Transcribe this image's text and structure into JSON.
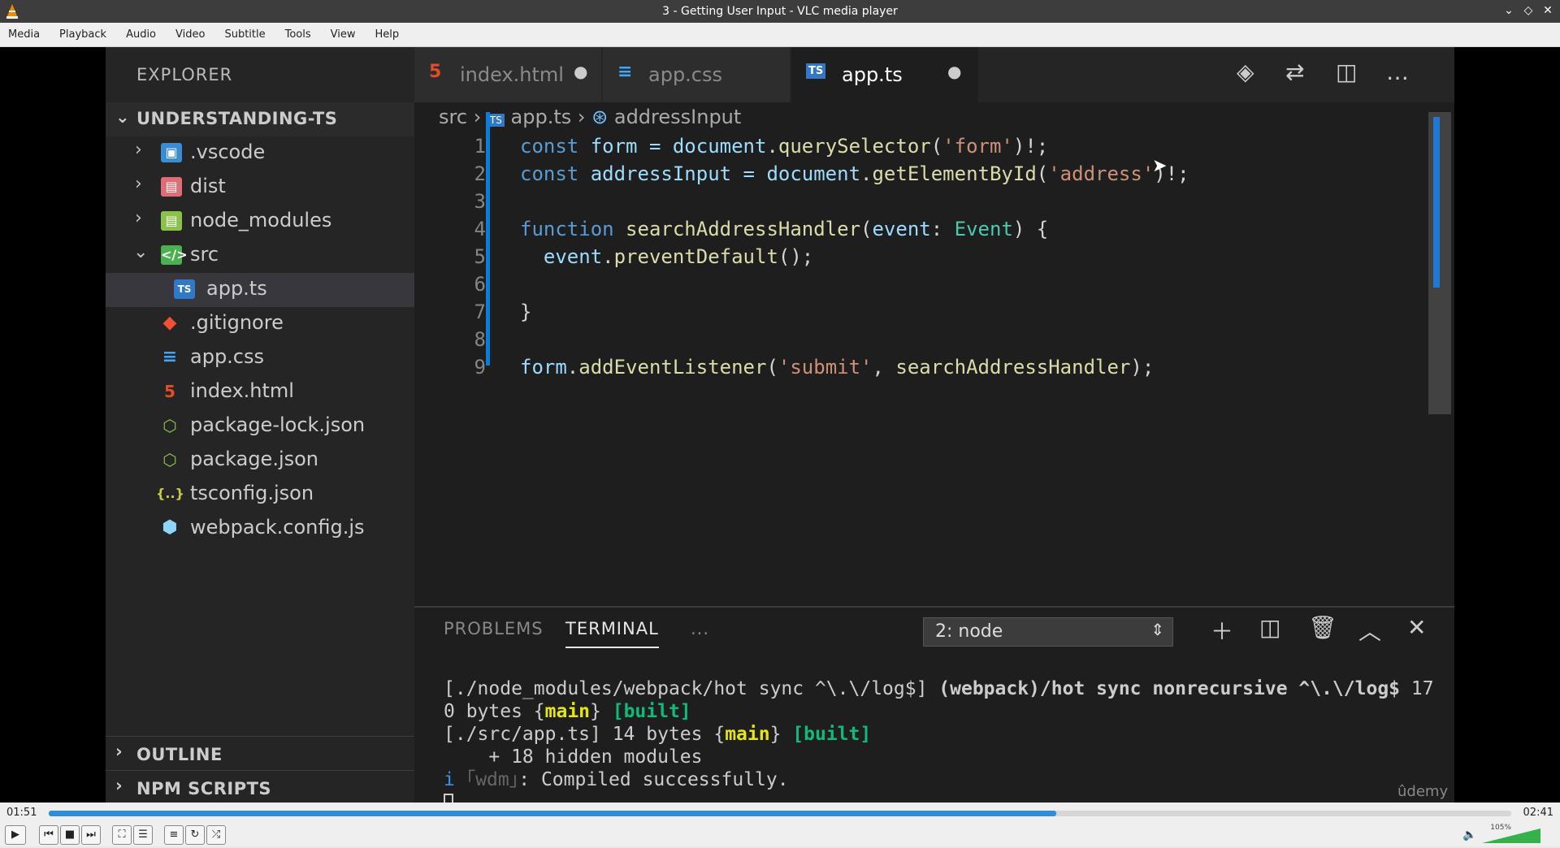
{
  "window": {
    "title": "3 - Getting User Input - VLC media player"
  },
  "menu": [
    "Media",
    "Playback",
    "Audio",
    "Video",
    "Subtitle",
    "Tools",
    "View",
    "Help"
  ],
  "explorer": {
    "title": "EXPLORER",
    "root": "UNDERSTANDING-TS",
    "items": [
      {
        "label": ".vscode",
        "icon": "folder-vscode-icon"
      },
      {
        "label": "dist",
        "icon": "folder-dist-icon"
      },
      {
        "label": "node_modules",
        "icon": "folder-node-icon"
      },
      {
        "label": "src",
        "icon": "folder-src-icon"
      },
      {
        "label": "app.ts",
        "icon": "ts-file-icon"
      },
      {
        "label": ".gitignore",
        "icon": "git-icon"
      },
      {
        "label": "app.css",
        "icon": "css-file-icon"
      },
      {
        "label": "index.html",
        "icon": "html-file-icon"
      },
      {
        "label": "package-lock.json",
        "icon": "node-file-icon"
      },
      {
        "label": "package.json",
        "icon": "node-file-icon"
      },
      {
        "label": "tsconfig.json",
        "icon": "json-file-icon"
      },
      {
        "label": "webpack.config.js",
        "icon": "webpack-icon"
      }
    ],
    "sections": [
      "OUTLINE",
      "NPM SCRIPTS"
    ]
  },
  "tabs": [
    {
      "label": "index.html",
      "icon": "html-file-icon"
    },
    {
      "label": "app.css",
      "icon": "css-file-icon"
    },
    {
      "label": "app.ts",
      "icon": "ts-file-icon"
    }
  ],
  "breadcrumb": {
    "folder": "src",
    "file": "app.ts",
    "symbol": "addressInput"
  },
  "code": {
    "line_numbers": [
      "1",
      "2",
      "3",
      "4",
      "5",
      "6",
      "7",
      "8",
      "9"
    ],
    "l1": {
      "a": "const",
      "b": " form = ",
      "c": "document",
      "d": ".",
      "e": "querySelector",
      "f": "(",
      "g": "'form'",
      "h": ")!;"
    },
    "l2": {
      "a": "const",
      "b": " addressInput = ",
      "c": "document",
      "d": ".",
      "e": "getElementById",
      "f": "(",
      "g": "'address'",
      "h": ")!;"
    },
    "l4": {
      "a": "function",
      "b": " ",
      "c": "searchAddressHandler",
      "d": "(",
      "e": "event",
      "f": ": ",
      "g": "Event",
      "h": ") {"
    },
    "l5": {
      "a": "  event",
      "b": ".",
      "c": "preventDefault",
      "d": "();"
    },
    "l7": {
      "a": "}"
    },
    "l9": {
      "a": "form",
      "b": ".",
      "c": "addEventListener",
      "d": "(",
      "e": "'submit'",
      "f": ", ",
      "g": "searchAddressHandler",
      "h": ");"
    }
  },
  "panel": {
    "tabs": [
      "PROBLEMS",
      "TERMINAL",
      "..."
    ],
    "select": "2: node",
    "terminal": {
      "l1a": "[./node_modules/webpack/hot sync ^\\.\\/log$] ",
      "l1b": "(webpack)/hot sync nonrecursive ^\\.\\/log$",
      "l1c": " 17",
      "l2a": "0 bytes {",
      "l2b": "main",
      "l2c": "} ",
      "l2d": "[built]",
      "l3a": "[./src/app.ts] 14 bytes {",
      "l3b": "main",
      "l3c": "} ",
      "l3d": "[built]",
      "l4": "    + 18 hidden modules",
      "l5a": "i ",
      "l5b": "｢wdm｣",
      "l5c": ": Compiled successfully."
    }
  },
  "watermark": "ûdemy",
  "player": {
    "elapsed": "01:51",
    "total": "02:41",
    "progress": 0.689,
    "volume": "105%"
  }
}
